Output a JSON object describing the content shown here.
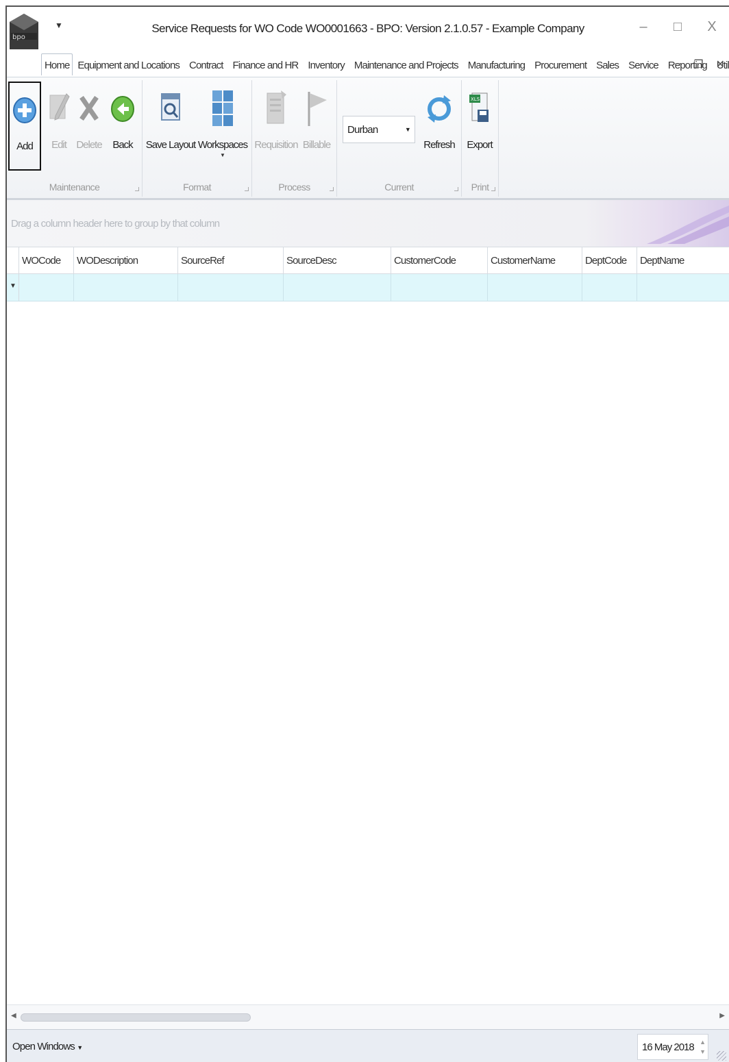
{
  "window": {
    "title": "Service Requests for WO Code WO0001663 - BPO: Version 2.1.0.57 - Example Company",
    "controls": [
      "–",
      "□",
      "X"
    ]
  },
  "menu": {
    "tabs": [
      "Home",
      "Equipment and Locations",
      "Contract",
      "Finance and HR",
      "Inventory",
      "Maintenance and Projects",
      "Manufacturing",
      "Procurement",
      "Sales",
      "Service",
      "Reporting",
      "Utilities"
    ],
    "active_tab": "Home"
  },
  "ribbon": {
    "maintenance": {
      "label": "Maintenance",
      "add": "Add",
      "edit": "Edit",
      "delete": "Delete",
      "back": "Back"
    },
    "format": {
      "label": "Format",
      "save_layout": "Save Layout",
      "workspaces": "Workspaces"
    },
    "process": {
      "label": "Process",
      "requisition": "Requisition",
      "billable": "Billable"
    },
    "current": {
      "label": "Current",
      "site_value": "Durban",
      "refresh": "Refresh"
    },
    "print": {
      "label": "Print",
      "export": "Export"
    }
  },
  "grid": {
    "group_hint": "Drag a column header here to group by that column",
    "columns": [
      "WOCode",
      "WODescription",
      "SourceRef",
      "SourceDesc",
      "CustomerCode",
      "CustomerName",
      "DeptCode",
      "DeptName"
    ]
  },
  "status": {
    "open_windows": "Open Windows",
    "date": "16 May 2018"
  },
  "colors": {
    "new_row_bg": "#dff7fb",
    "ribbon_bg": "#f0f2f5",
    "status_bg": "#e9edf3"
  }
}
